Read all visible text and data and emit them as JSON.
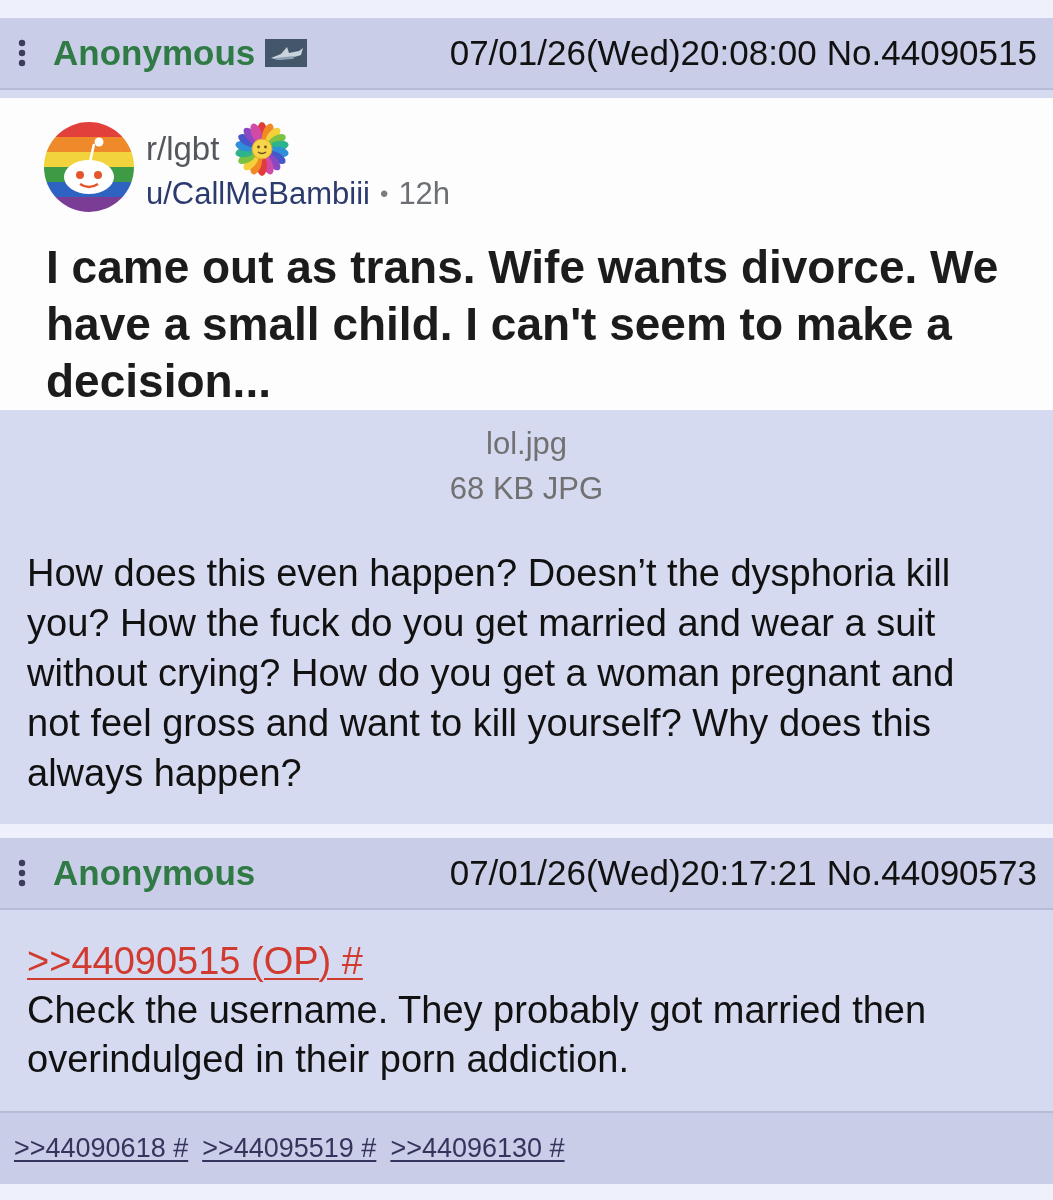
{
  "posts": [
    {
      "poster_name": "Anonymous",
      "flag": true,
      "datetime": "07/01/26(Wed)20:08:00",
      "post_number": "No.44090515",
      "embed": {
        "subreddit": "r/lgbt",
        "username": "u/CallMeBambiii",
        "separator": "•",
        "age": "12h",
        "title": "I came out as trans. Wife wants divorce. We have a small child. I can't seem to make a decision..."
      },
      "file": {
        "name": "lol.jpg",
        "size": "68 KB JPG"
      },
      "comment": "How does this even happen? Doesn’t the dysphoria kill you? How the fuck do you get married and wear a suit without crying? How do you get a woman pregnant and not feel gross and want to kill yourself? Why does this always happen?"
    },
    {
      "poster_name": "Anonymous",
      "flag": false,
      "datetime": "07/01/26(Wed)20:17:21",
      "post_number": "No.44090573",
      "quote_link": ">>44090515 (OP) #",
      "comment": "Check the username. They probably got married then overindulged in their porn addiction.",
      "backlinks": [
        ">>44090618 #",
        ">>44095519 #",
        ">>44096130 #"
      ]
    }
  ]
}
